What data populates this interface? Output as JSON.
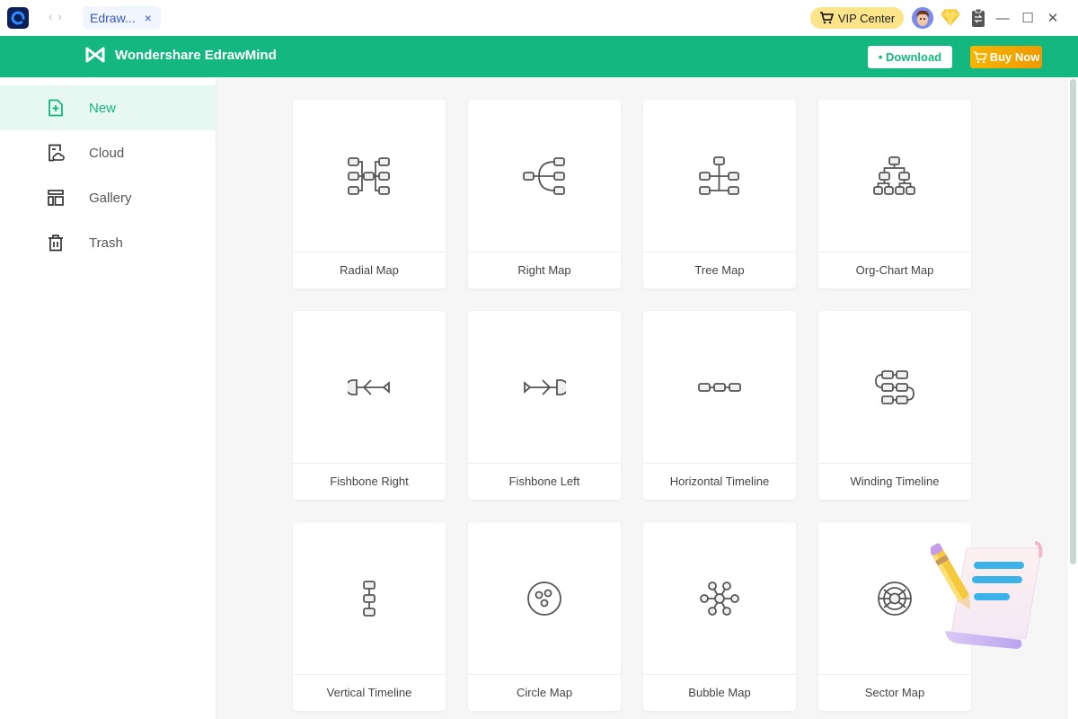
{
  "titlebar": {
    "tab_label": "Edraw...",
    "tab_close": "×",
    "nav_back": "‹",
    "nav_forward": "›",
    "vip_label": "VIP Center",
    "minimize": "—",
    "maximize": "☐",
    "close": "✕"
  },
  "header": {
    "brand": "Wondershare EdrawMind",
    "download_label": "• Download",
    "buy_label": "Buy Now",
    "accent_color": "#13b77f"
  },
  "sidebar": {
    "items": [
      {
        "label": "New",
        "icon": "new-file-icon",
        "active": true
      },
      {
        "label": "Cloud",
        "icon": "cloud-file-icon",
        "active": false
      },
      {
        "label": "Gallery",
        "icon": "gallery-icon",
        "active": false
      },
      {
        "label": "Trash",
        "icon": "trash-icon",
        "active": false
      }
    ]
  },
  "templates": [
    {
      "label": "Radial Map",
      "icon": "radial-map-icon"
    },
    {
      "label": "Right Map",
      "icon": "right-map-icon"
    },
    {
      "label": "Tree Map",
      "icon": "tree-map-icon"
    },
    {
      "label": "Org-Chart Map",
      "icon": "org-chart-icon"
    },
    {
      "label": "Fishbone Right",
      "icon": "fishbone-right-icon"
    },
    {
      "label": "Fishbone Left",
      "icon": "fishbone-left-icon"
    },
    {
      "label": "Horizontal Timeline",
      "icon": "horizontal-timeline-icon"
    },
    {
      "label": "Winding Timeline",
      "icon": "winding-timeline-icon"
    },
    {
      "label": "Vertical Timeline",
      "icon": "vertical-timeline-icon"
    },
    {
      "label": "Circle Map",
      "icon": "circle-map-icon"
    },
    {
      "label": "Bubble Map",
      "icon": "bubble-map-icon"
    },
    {
      "label": "Sector Map",
      "icon": "sector-map-icon"
    }
  ]
}
